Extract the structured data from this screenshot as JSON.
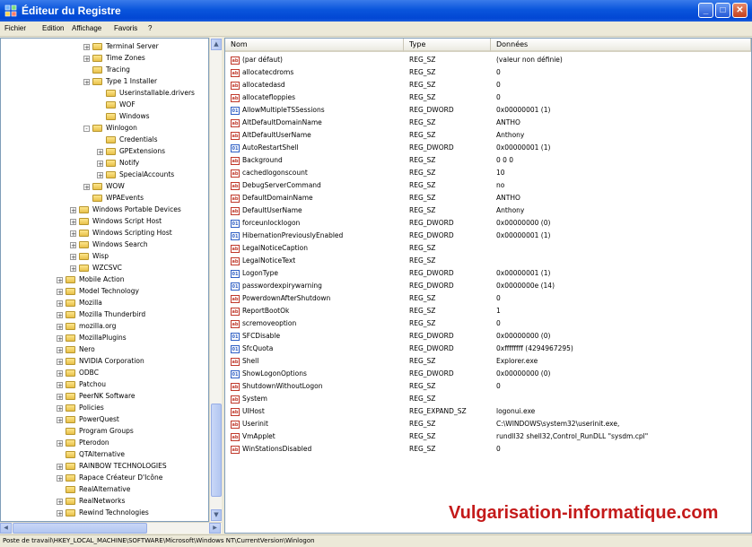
{
  "window": {
    "title": "Éditeur du Registre",
    "min_label": "_",
    "max_label": "□",
    "close_label": "✕"
  },
  "menu": [
    "Fichier",
    "Edition",
    "Affichage",
    "Favoris",
    "?"
  ],
  "tree": [
    {
      "label": "Terminal Server",
      "indent": 3,
      "expander": "+"
    },
    {
      "label": "Time Zones",
      "indent": 3,
      "expander": "+"
    },
    {
      "label": "Tracing",
      "indent": 3,
      "expander": ""
    },
    {
      "label": "Type 1 Installer",
      "indent": 3,
      "expander": "+"
    },
    {
      "label": "Userinstallable.drivers",
      "indent": 4,
      "expander": ""
    },
    {
      "label": "WOF",
      "indent": 4,
      "expander": ""
    },
    {
      "label": "Windows",
      "indent": 4,
      "expander": ""
    },
    {
      "label": "Winlogon",
      "indent": 3,
      "expander": "-"
    },
    {
      "label": "Credentials",
      "indent": 4,
      "expander": ""
    },
    {
      "label": "GPExtensions",
      "indent": 4,
      "expander": "+"
    },
    {
      "label": "Notify",
      "indent": 4,
      "expander": "+"
    },
    {
      "label": "SpecialAccounts",
      "indent": 4,
      "expander": "+"
    },
    {
      "label": "WOW",
      "indent": 3,
      "expander": "+"
    },
    {
      "label": "WPAEvents",
      "indent": 3,
      "expander": ""
    },
    {
      "label": "Windows Portable Devices",
      "indent": 2,
      "expander": "+"
    },
    {
      "label": "Windows Script Host",
      "indent": 2,
      "expander": "+"
    },
    {
      "label": "Windows Scripting Host",
      "indent": 2,
      "expander": "+"
    },
    {
      "label": "Windows Search",
      "indent": 2,
      "expander": "+"
    },
    {
      "label": "Wisp",
      "indent": 2,
      "expander": "+"
    },
    {
      "label": "WZCSVC",
      "indent": 2,
      "expander": "+"
    },
    {
      "label": "Mobile Action",
      "indent": 1,
      "expander": "+"
    },
    {
      "label": "Model Technology",
      "indent": 1,
      "expander": "+"
    },
    {
      "label": "Mozilla",
      "indent": 1,
      "expander": "+"
    },
    {
      "label": "Mozilla Thunderbird",
      "indent": 1,
      "expander": "+"
    },
    {
      "label": "mozilla.org",
      "indent": 1,
      "expander": "+"
    },
    {
      "label": "MozillaPlugins",
      "indent": 1,
      "expander": "+"
    },
    {
      "label": "Nero",
      "indent": 1,
      "expander": "+"
    },
    {
      "label": "NVIDIA Corporation",
      "indent": 1,
      "expander": "+"
    },
    {
      "label": "ODBC",
      "indent": 1,
      "expander": "+"
    },
    {
      "label": "Patchou",
      "indent": 1,
      "expander": "+"
    },
    {
      "label": "PeerNK Software",
      "indent": 1,
      "expander": "+"
    },
    {
      "label": "Policies",
      "indent": 1,
      "expander": "+"
    },
    {
      "label": "PowerQuest",
      "indent": 1,
      "expander": "+"
    },
    {
      "label": "Program Groups",
      "indent": 1,
      "expander": ""
    },
    {
      "label": "Pterodon",
      "indent": 1,
      "expander": "+"
    },
    {
      "label": "QTAlternative",
      "indent": 1,
      "expander": ""
    },
    {
      "label": "RAINBOW TECHNOLOGIES",
      "indent": 1,
      "expander": "+"
    },
    {
      "label": "Rapace Créateur D'Icône",
      "indent": 1,
      "expander": "+"
    },
    {
      "label": "RealAlternative",
      "indent": 1,
      "expander": ""
    },
    {
      "label": "RealNetworks",
      "indent": 1,
      "expander": "+"
    },
    {
      "label": "Rewind Technologies",
      "indent": 1,
      "expander": "+"
    }
  ],
  "columns": {
    "name": "Nom",
    "type": "Type",
    "data": "Données"
  },
  "values": [
    {
      "name": "(par défaut)",
      "type": "REG_SZ",
      "data": "(valeur non définie)",
      "icon": "string-value-icon"
    },
    {
      "name": "allocatecdroms",
      "type": "REG_SZ",
      "data": "0",
      "icon": "string-value-icon"
    },
    {
      "name": "allocatedasd",
      "type": "REG_SZ",
      "data": "0",
      "icon": "string-value-icon"
    },
    {
      "name": "allocatefloppies",
      "type": "REG_SZ",
      "data": "0",
      "icon": "string-value-icon"
    },
    {
      "name": "AllowMultipleTSSessions",
      "type": "REG_DWORD",
      "data": "0x00000001 (1)",
      "icon": "dword-value-icon"
    },
    {
      "name": "AltDefaultDomainName",
      "type": "REG_SZ",
      "data": "ANTHO",
      "icon": "string-value-icon"
    },
    {
      "name": "AltDefaultUserName",
      "type": "REG_SZ",
      "data": "Anthony",
      "icon": "string-value-icon"
    },
    {
      "name": "AutoRestartShell",
      "type": "REG_DWORD",
      "data": "0x00000001 (1)",
      "icon": "dword-value-icon"
    },
    {
      "name": "Background",
      "type": "REG_SZ",
      "data": "0 0 0",
      "icon": "string-value-icon"
    },
    {
      "name": "cachedlogonscount",
      "type": "REG_SZ",
      "data": "10",
      "icon": "string-value-icon"
    },
    {
      "name": "DebugServerCommand",
      "type": "REG_SZ",
      "data": "no",
      "icon": "string-value-icon"
    },
    {
      "name": "DefaultDomainName",
      "type": "REG_SZ",
      "data": "ANTHO",
      "icon": "string-value-icon"
    },
    {
      "name": "DefaultUserName",
      "type": "REG_SZ",
      "data": "Anthony",
      "icon": "string-value-icon"
    },
    {
      "name": "forceunlocklogon",
      "type": "REG_DWORD",
      "data": "0x00000000 (0)",
      "icon": "dword-value-icon"
    },
    {
      "name": "HibernationPreviouslyEnabled",
      "type": "REG_DWORD",
      "data": "0x00000001 (1)",
      "icon": "dword-value-icon"
    },
    {
      "name": "LegalNoticeCaption",
      "type": "REG_SZ",
      "data": "",
      "icon": "string-value-icon"
    },
    {
      "name": "LegalNoticeText",
      "type": "REG_SZ",
      "data": "",
      "icon": "string-value-icon"
    },
    {
      "name": "LogonType",
      "type": "REG_DWORD",
      "data": "0x00000001 (1)",
      "icon": "dword-value-icon"
    },
    {
      "name": "passwordexpirywarning",
      "type": "REG_DWORD",
      "data": "0x0000000e (14)",
      "icon": "dword-value-icon"
    },
    {
      "name": "PowerdownAfterShutdown",
      "type": "REG_SZ",
      "data": "0",
      "icon": "string-value-icon"
    },
    {
      "name": "ReportBootOk",
      "type": "REG_SZ",
      "data": "1",
      "icon": "string-value-icon"
    },
    {
      "name": "scremoveoption",
      "type": "REG_SZ",
      "data": "0",
      "icon": "string-value-icon"
    },
    {
      "name": "SFCDisable",
      "type": "REG_DWORD",
      "data": "0x00000000 (0)",
      "icon": "dword-value-icon"
    },
    {
      "name": "SfcQuota",
      "type": "REG_DWORD",
      "data": "0xffffffff (4294967295)",
      "icon": "dword-value-icon"
    },
    {
      "name": "Shell",
      "type": "REG_SZ",
      "data": "Explorer.exe",
      "icon": "string-value-icon"
    },
    {
      "name": "ShowLogonOptions",
      "type": "REG_DWORD",
      "data": "0x00000000 (0)",
      "icon": "dword-value-icon"
    },
    {
      "name": "ShutdownWithoutLogon",
      "type": "REG_SZ",
      "data": "0",
      "icon": "string-value-icon"
    },
    {
      "name": "System",
      "type": "REG_SZ",
      "data": "",
      "icon": "string-value-icon"
    },
    {
      "name": "UIHost",
      "type": "REG_EXPAND_SZ",
      "data": "logonui.exe",
      "icon": "string-value-icon"
    },
    {
      "name": "Userinit",
      "type": "REG_SZ",
      "data": "C:\\WINDOWS\\system32\\userinit.exe,",
      "icon": "string-value-icon"
    },
    {
      "name": "VmApplet",
      "type": "REG_SZ",
      "data": "rundll32 shell32,Control_RunDLL \"sysdm.cpl\"",
      "icon": "string-value-icon"
    },
    {
      "name": "WinStationsDisabled",
      "type": "REG_SZ",
      "data": "0",
      "icon": "string-value-icon"
    }
  ],
  "watermark": "Vulgarisation-informatique.com",
  "status": "Poste de travail\\HKEY_LOCAL_MACHINE\\SOFTWARE\\Microsoft\\Windows NT\\CurrentVersion\\Winlogon",
  "colors": {
    "titlebar": "#0a55dc",
    "watermark": "#c41a1a"
  }
}
